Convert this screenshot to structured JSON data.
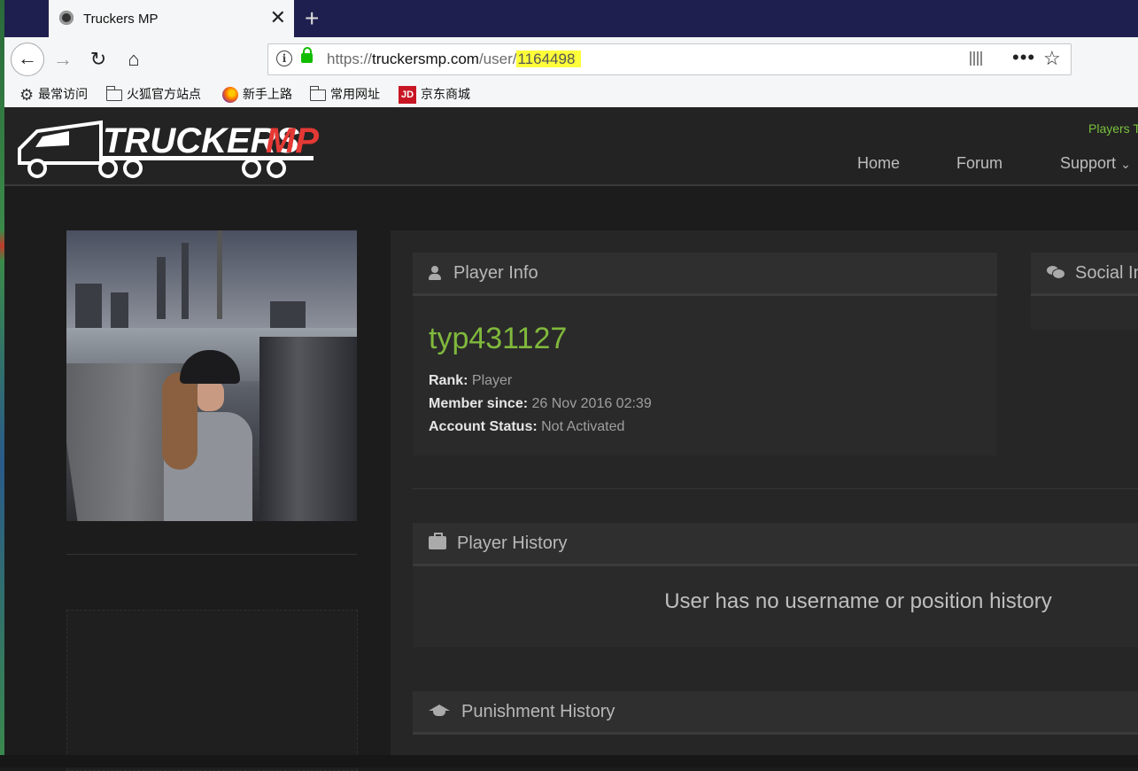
{
  "browser": {
    "tab_title": "Truckers MP",
    "tab_close": "✕",
    "new_tab": "+",
    "url_prefix": "https://",
    "url_host": "truckersmp.com",
    "url_path": "/user/",
    "url_highlight": "1164498",
    "nav_back": "←",
    "nav_forward": "→",
    "nav_reload": "↻",
    "nav_home": "⌂",
    "menu_dots": "•••",
    "bookmark_star": "☆",
    "bookmarks": [
      {
        "label": "最常访问",
        "icon": "gear-icon"
      },
      {
        "label": "火狐官方站点",
        "icon": "folder-icon"
      },
      {
        "label": "新手上路",
        "icon": "firefox-icon"
      },
      {
        "label": "常用网址",
        "icon": "folder-icon"
      },
      {
        "label": "京东商城",
        "icon": "jd-icon"
      }
    ],
    "jd_glyph": "JD",
    "gear_glyph": "⚙"
  },
  "site": {
    "logo_text_a": "TRUCKERS",
    "logo_text_b": "MP",
    "players_text": "Players T",
    "menu": [
      "Home",
      "Forum",
      "Support"
    ],
    "support_chevron": "⌄"
  },
  "profile": {
    "player_info_title": "Player Info",
    "social_title": "Social In",
    "username": "typ431127",
    "rank_label": "Rank:",
    "rank_value": "Player",
    "member_label": "Member since:",
    "member_value": "26 Nov 2016 02:39",
    "status_label": "Account Status:",
    "status_value": "Not Activated",
    "history_title": "Player History",
    "history_empty": "User has no username or position history",
    "punishment_title": "Punishment History"
  },
  "colors": {
    "accent_green": "#80b83c",
    "url_highlight": "#fdfd3a",
    "tabstrip": "#1f1f4f"
  }
}
